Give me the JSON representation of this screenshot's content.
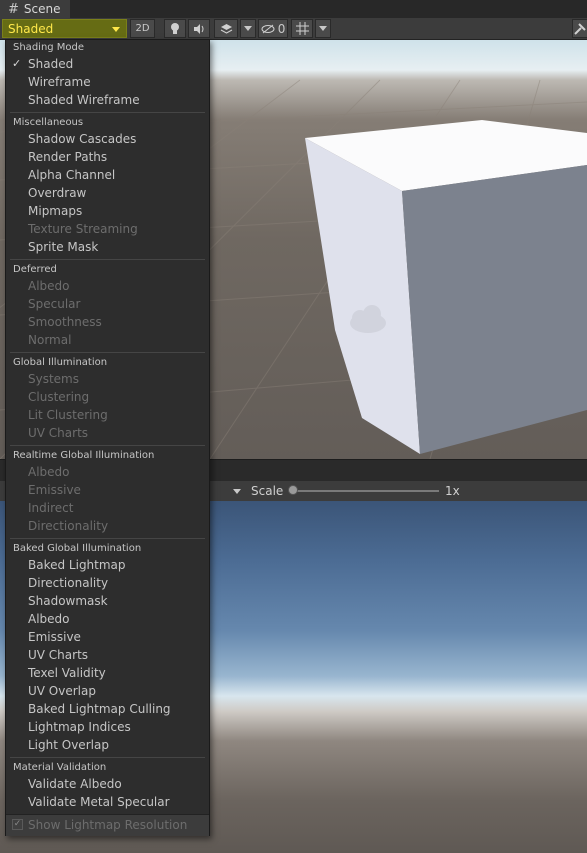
{
  "tab": {
    "icon": "hash-icon",
    "title": "Scene"
  },
  "toolbar": {
    "shading_value": "Shaded",
    "mode_2d": "2D",
    "hidden_count": "0",
    "accent_color": "#666c14",
    "accent_text_color": "#ffe84a"
  },
  "menu": {
    "shading_mode": {
      "header": "Shading Mode",
      "checked_mark": "✓",
      "items": [
        {
          "label": "Shaded",
          "checked": true,
          "enabled": true
        },
        {
          "label": "Wireframe",
          "checked": false,
          "enabled": true
        },
        {
          "label": "Shaded Wireframe",
          "checked": false,
          "enabled": true
        }
      ]
    },
    "miscellaneous": {
      "header": "Miscellaneous",
      "items": [
        {
          "label": "Shadow Cascades",
          "enabled": true
        },
        {
          "label": "Render Paths",
          "enabled": true
        },
        {
          "label": "Alpha Channel",
          "enabled": true
        },
        {
          "label": "Overdraw",
          "enabled": true
        },
        {
          "label": "Mipmaps",
          "enabled": true
        },
        {
          "label": "Texture Streaming",
          "enabled": false
        },
        {
          "label": "Sprite Mask",
          "enabled": true
        }
      ]
    },
    "deferred": {
      "header": "Deferred",
      "items": [
        {
          "label": "Albedo",
          "enabled": false
        },
        {
          "label": "Specular",
          "enabled": false
        },
        {
          "label": "Smoothness",
          "enabled": false
        },
        {
          "label": "Normal",
          "enabled": false
        }
      ]
    },
    "global_illumination": {
      "header": "Global Illumination",
      "items": [
        {
          "label": "Systems",
          "enabled": false
        },
        {
          "label": "Clustering",
          "enabled": false
        },
        {
          "label": "Lit Clustering",
          "enabled": false
        },
        {
          "label": "UV Charts",
          "enabled": false
        }
      ]
    },
    "realtime_gi": {
      "header": "Realtime Global Illumination",
      "items": [
        {
          "label": "Albedo",
          "enabled": false
        },
        {
          "label": "Emissive",
          "enabled": false
        },
        {
          "label": "Indirect",
          "enabled": false
        },
        {
          "label": "Directionality",
          "enabled": false
        }
      ]
    },
    "baked_gi": {
      "header": "Baked Global Illumination",
      "items": [
        {
          "label": "Baked Lightmap",
          "enabled": true
        },
        {
          "label": "Directionality",
          "enabled": true
        },
        {
          "label": "Shadowmask",
          "enabled": true
        },
        {
          "label": "Albedo",
          "enabled": true
        },
        {
          "label": "Emissive",
          "enabled": true
        },
        {
          "label": "UV Charts",
          "enabled": true
        },
        {
          "label": "Texel Validity",
          "enabled": true
        },
        {
          "label": "UV Overlap",
          "enabled": true
        },
        {
          "label": "Baked Lightmap Culling",
          "enabled": true
        },
        {
          "label": "Lightmap Indices",
          "enabled": true
        },
        {
          "label": "Light Overlap",
          "enabled": true
        }
      ]
    },
    "material_validation": {
      "header": "Material Validation",
      "items": [
        {
          "label": "Validate Albedo",
          "enabled": true
        },
        {
          "label": "Validate Metal Specular",
          "enabled": true
        }
      ]
    },
    "show_lightmap_resolution": {
      "label": "Show Lightmap Resolution",
      "checked": true,
      "enabled": false
    }
  },
  "game_toolbar": {
    "scale_label": "Scale",
    "scale_value": "1x",
    "scale_level": 0
  }
}
